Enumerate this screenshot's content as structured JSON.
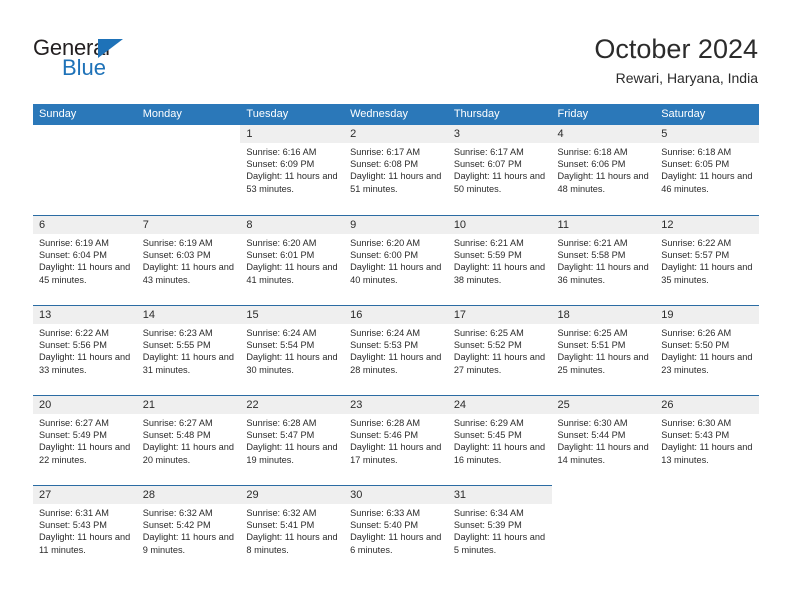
{
  "brand": {
    "name_part1": "General",
    "name_part2": "Blue",
    "triangle_icon": "blue-triangle-icon",
    "colors": {
      "dark": "#231f20",
      "blue": "#1e72b8"
    }
  },
  "header": {
    "title": "October 2024",
    "subtitle": "Rewari, Haryana, India"
  },
  "colors": {
    "header_blue": "#2b78b9",
    "row_separator": "#2b6ca3",
    "daynum_band": "#efefef",
    "text": "#2b2b2b"
  },
  "weekdays": [
    "Sunday",
    "Monday",
    "Tuesday",
    "Wednesday",
    "Thursday",
    "Friday",
    "Saturday"
  ],
  "labels": {
    "sunrise": "Sunrise:",
    "sunset": "Sunset:",
    "daylight": "Daylight:"
  },
  "weeks": [
    [
      {
        "day": "",
        "empty": true
      },
      {
        "day": "",
        "empty": true
      },
      {
        "day": "1",
        "sunrise": "Sunrise: 6:16 AM",
        "sunset": "Sunset: 6:09 PM",
        "daylight": "Daylight: 11 hours and 53 minutes."
      },
      {
        "day": "2",
        "sunrise": "Sunrise: 6:17 AM",
        "sunset": "Sunset: 6:08 PM",
        "daylight": "Daylight: 11 hours and 51 minutes."
      },
      {
        "day": "3",
        "sunrise": "Sunrise: 6:17 AM",
        "sunset": "Sunset: 6:07 PM",
        "daylight": "Daylight: 11 hours and 50 minutes."
      },
      {
        "day": "4",
        "sunrise": "Sunrise: 6:18 AM",
        "sunset": "Sunset: 6:06 PM",
        "daylight": "Daylight: 11 hours and 48 minutes."
      },
      {
        "day": "5",
        "sunrise": "Sunrise: 6:18 AM",
        "sunset": "Sunset: 6:05 PM",
        "daylight": "Daylight: 11 hours and 46 minutes."
      }
    ],
    [
      {
        "day": "6",
        "sunrise": "Sunrise: 6:19 AM",
        "sunset": "Sunset: 6:04 PM",
        "daylight": "Daylight: 11 hours and 45 minutes."
      },
      {
        "day": "7",
        "sunrise": "Sunrise: 6:19 AM",
        "sunset": "Sunset: 6:03 PM",
        "daylight": "Daylight: 11 hours and 43 minutes."
      },
      {
        "day": "8",
        "sunrise": "Sunrise: 6:20 AM",
        "sunset": "Sunset: 6:01 PM",
        "daylight": "Daylight: 11 hours and 41 minutes."
      },
      {
        "day": "9",
        "sunrise": "Sunrise: 6:20 AM",
        "sunset": "Sunset: 6:00 PM",
        "daylight": "Daylight: 11 hours and 40 minutes."
      },
      {
        "day": "10",
        "sunrise": "Sunrise: 6:21 AM",
        "sunset": "Sunset: 5:59 PM",
        "daylight": "Daylight: 11 hours and 38 minutes."
      },
      {
        "day": "11",
        "sunrise": "Sunrise: 6:21 AM",
        "sunset": "Sunset: 5:58 PM",
        "daylight": "Daylight: 11 hours and 36 minutes."
      },
      {
        "day": "12",
        "sunrise": "Sunrise: 6:22 AM",
        "sunset": "Sunset: 5:57 PM",
        "daylight": "Daylight: 11 hours and 35 minutes."
      }
    ],
    [
      {
        "day": "13",
        "sunrise": "Sunrise: 6:22 AM",
        "sunset": "Sunset: 5:56 PM",
        "daylight": "Daylight: 11 hours and 33 minutes."
      },
      {
        "day": "14",
        "sunrise": "Sunrise: 6:23 AM",
        "sunset": "Sunset: 5:55 PM",
        "daylight": "Daylight: 11 hours and 31 minutes."
      },
      {
        "day": "15",
        "sunrise": "Sunrise: 6:24 AM",
        "sunset": "Sunset: 5:54 PM",
        "daylight": "Daylight: 11 hours and 30 minutes."
      },
      {
        "day": "16",
        "sunrise": "Sunrise: 6:24 AM",
        "sunset": "Sunset: 5:53 PM",
        "daylight": "Daylight: 11 hours and 28 minutes."
      },
      {
        "day": "17",
        "sunrise": "Sunrise: 6:25 AM",
        "sunset": "Sunset: 5:52 PM",
        "daylight": "Daylight: 11 hours and 27 minutes."
      },
      {
        "day": "18",
        "sunrise": "Sunrise: 6:25 AM",
        "sunset": "Sunset: 5:51 PM",
        "daylight": "Daylight: 11 hours and 25 minutes."
      },
      {
        "day": "19",
        "sunrise": "Sunrise: 6:26 AM",
        "sunset": "Sunset: 5:50 PM",
        "daylight": "Daylight: 11 hours and 23 minutes."
      }
    ],
    [
      {
        "day": "20",
        "sunrise": "Sunrise: 6:27 AM",
        "sunset": "Sunset: 5:49 PM",
        "daylight": "Daylight: 11 hours and 22 minutes."
      },
      {
        "day": "21",
        "sunrise": "Sunrise: 6:27 AM",
        "sunset": "Sunset: 5:48 PM",
        "daylight": "Daylight: 11 hours and 20 minutes."
      },
      {
        "day": "22",
        "sunrise": "Sunrise: 6:28 AM",
        "sunset": "Sunset: 5:47 PM",
        "daylight": "Daylight: 11 hours and 19 minutes."
      },
      {
        "day": "23",
        "sunrise": "Sunrise: 6:28 AM",
        "sunset": "Sunset: 5:46 PM",
        "daylight": "Daylight: 11 hours and 17 minutes."
      },
      {
        "day": "24",
        "sunrise": "Sunrise: 6:29 AM",
        "sunset": "Sunset: 5:45 PM",
        "daylight": "Daylight: 11 hours and 16 minutes."
      },
      {
        "day": "25",
        "sunrise": "Sunrise: 6:30 AM",
        "sunset": "Sunset: 5:44 PM",
        "daylight": "Daylight: 11 hours and 14 minutes."
      },
      {
        "day": "26",
        "sunrise": "Sunrise: 6:30 AM",
        "sunset": "Sunset: 5:43 PM",
        "daylight": "Daylight: 11 hours and 13 minutes."
      }
    ],
    [
      {
        "day": "27",
        "sunrise": "Sunrise: 6:31 AM",
        "sunset": "Sunset: 5:43 PM",
        "daylight": "Daylight: 11 hours and 11 minutes."
      },
      {
        "day": "28",
        "sunrise": "Sunrise: 6:32 AM",
        "sunset": "Sunset: 5:42 PM",
        "daylight": "Daylight: 11 hours and 9 minutes."
      },
      {
        "day": "29",
        "sunrise": "Sunrise: 6:32 AM",
        "sunset": "Sunset: 5:41 PM",
        "daylight": "Daylight: 11 hours and 8 minutes."
      },
      {
        "day": "30",
        "sunrise": "Sunrise: 6:33 AM",
        "sunset": "Sunset: 5:40 PM",
        "daylight": "Daylight: 11 hours and 6 minutes."
      },
      {
        "day": "31",
        "sunrise": "Sunrise: 6:34 AM",
        "sunset": "Sunset: 5:39 PM",
        "daylight": "Daylight: 11 hours and 5 minutes."
      },
      {
        "day": "",
        "empty": true
      },
      {
        "day": "",
        "empty": true
      }
    ]
  ]
}
